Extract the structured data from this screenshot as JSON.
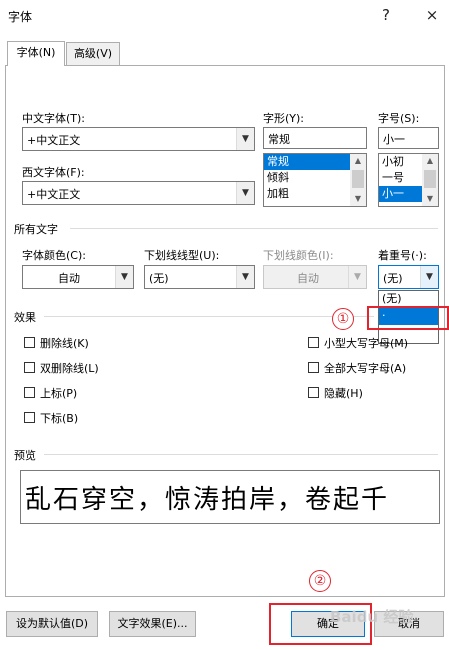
{
  "window": {
    "title": "字体",
    "help_glyph": "?",
    "close_glyph": "×"
  },
  "tabs": [
    {
      "label": "字体(N)"
    },
    {
      "label": "高级(V)"
    }
  ],
  "fonts": {
    "chinese_label": "中文字体(T):",
    "chinese_value": "+中文正文",
    "western_label": "西文字体(F):",
    "western_value": "+中文正文",
    "style_label": "字形(Y):",
    "style_value": "常规",
    "style_options": [
      "常规",
      "倾斜",
      "加粗"
    ],
    "size_label": "字号(S):",
    "size_value": "小一",
    "size_options": [
      "小初",
      "一号",
      "小一"
    ]
  },
  "all_text": {
    "section": "所有文字",
    "color_label": "字体颜色(C):",
    "color_value": "自动",
    "underline_label": "下划线线型(U):",
    "underline_value": "(无)",
    "underline_color_label": "下划线颜色(I):",
    "underline_color_value": "自动",
    "emphasis_label": "着重号(·):",
    "emphasis_value": "(无)",
    "emphasis_options": [
      "(无)",
      "·"
    ]
  },
  "effects": {
    "section": "效果",
    "left": [
      "删除线(K)",
      "双删除线(L)",
      "上标(P)",
      "下标(B)"
    ],
    "right": [
      "小型大写字母(M)",
      "全部大写字母(A)",
      "隐藏(H)"
    ]
  },
  "preview": {
    "section": "预览",
    "text": "乱石穿空，惊涛拍岸，卷起千"
  },
  "buttons": {
    "set_default": "设为默认值(D)",
    "text_effects": "文字效果(E)...",
    "ok": "确定",
    "cancel": "取消"
  },
  "annotations": {
    "step1": "①",
    "step2": "②",
    "accent_color": "#e1242d"
  },
  "watermark": {
    "text": "Baidu 经验"
  }
}
